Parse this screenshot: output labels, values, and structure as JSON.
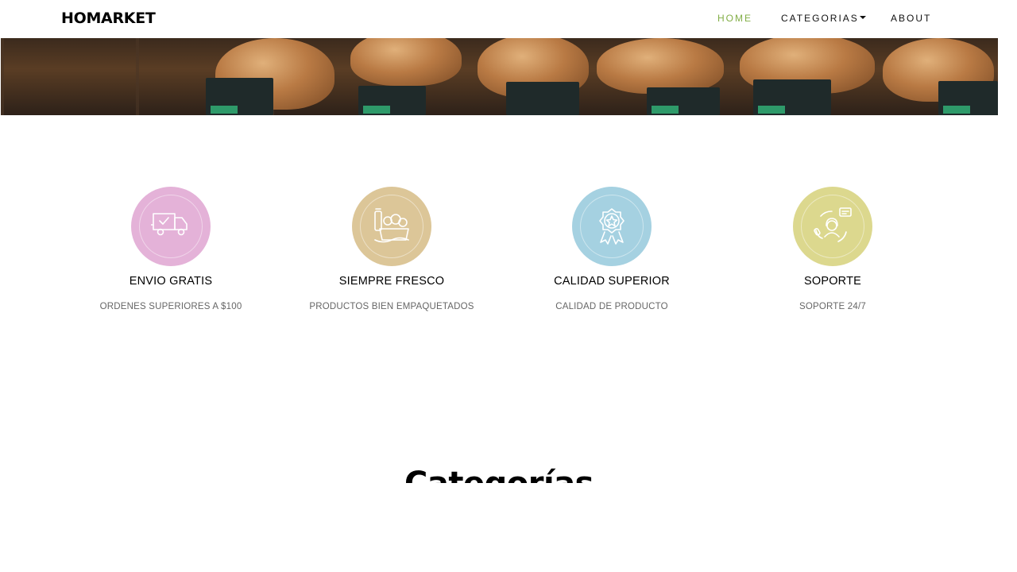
{
  "nav": {
    "brand": "HOMARKET",
    "items": [
      {
        "label": "HOME",
        "active": true
      },
      {
        "label": "CATEGORIAS",
        "dropdown": true
      },
      {
        "label": "ABOUT"
      }
    ],
    "active_color": "#82ae46"
  },
  "features": [
    {
      "title": "ENVIO GRATIS",
      "subtitle": "ORDENES SUPERIORES A $100",
      "color": "#e4b2d8",
      "icon": "delivery-truck-icon"
    },
    {
      "title": "SIEMPRE FRESCO",
      "subtitle": "PRODUCTOS BIEN EMPAQUETADOS",
      "color": "#dcc698",
      "icon": "fresh-groceries-icon"
    },
    {
      "title": "CALIDAD SUPERIOR",
      "subtitle": "CALIDAD DE PRODUCTO",
      "color": "#a5d1e1",
      "icon": "quality-badge-icon"
    },
    {
      "title": "SOPORTE",
      "subtitle": "SOPORTE 24/7",
      "color": "#dcd88e",
      "icon": "support-agent-icon"
    }
  ],
  "categories_heading": "Categorías"
}
